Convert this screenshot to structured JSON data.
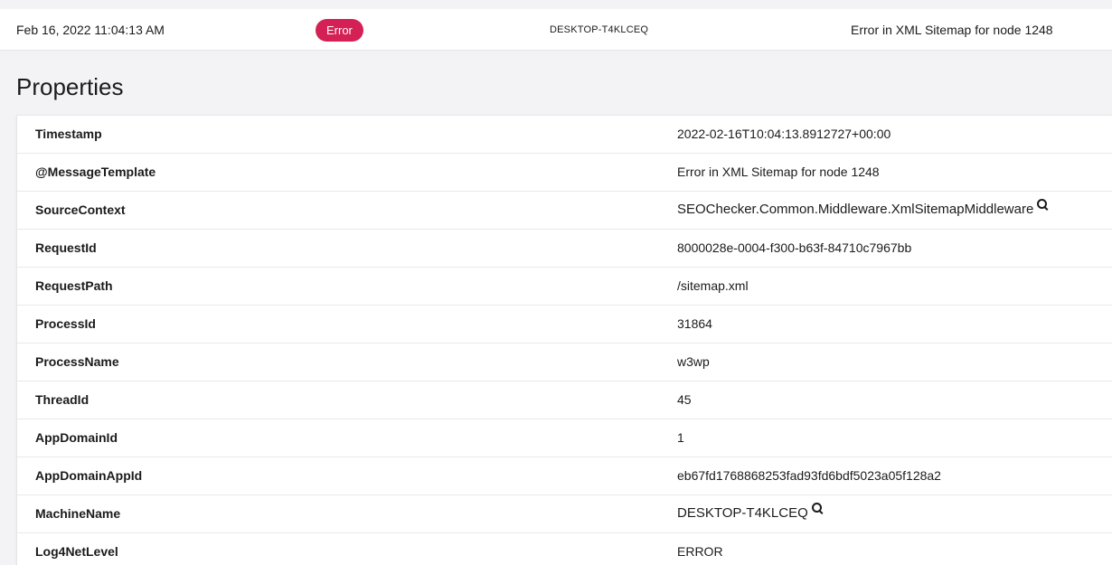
{
  "entry": {
    "timestamp": "Feb 16, 2022 11:04:13 AM",
    "level": "Error",
    "machine": "DESKTOP-T4KLCEQ",
    "message": "Error in XML Sitemap for node 1248"
  },
  "properties_heading": "Properties",
  "properties": [
    {
      "name": "Timestamp",
      "value": "2022-02-16T10:04:13.8912727+00:00",
      "searchable": false
    },
    {
      "name": "@MessageTemplate",
      "value": "Error in XML Sitemap for node 1248",
      "searchable": false
    },
    {
      "name": "SourceContext",
      "value": "SEOChecker.Common.Middleware.XmlSitemapMiddleware",
      "searchable": true
    },
    {
      "name": "RequestId",
      "value": "8000028e-0004-f300-b63f-84710c7967bb",
      "searchable": false
    },
    {
      "name": "RequestPath",
      "value": "/sitemap.xml",
      "searchable": false
    },
    {
      "name": "ProcessId",
      "value": "31864",
      "searchable": false
    },
    {
      "name": "ProcessName",
      "value": "w3wp",
      "searchable": false
    },
    {
      "name": "ThreadId",
      "value": "45",
      "searchable": false
    },
    {
      "name": "AppDomainId",
      "value": "1",
      "searchable": false
    },
    {
      "name": "AppDomainAppId",
      "value": "eb67fd1768868253fad93fd6bdf5023a05f128a2",
      "searchable": false
    },
    {
      "name": "MachineName",
      "value": "DESKTOP-T4KLCEQ",
      "searchable": true
    },
    {
      "name": "Log4NetLevel",
      "value": "ERROR",
      "searchable": false
    }
  ],
  "icons": {
    "search": "search-icon"
  },
  "colors": {
    "error_badge": "#d42054",
    "page_bg": "#f3f3f5"
  }
}
